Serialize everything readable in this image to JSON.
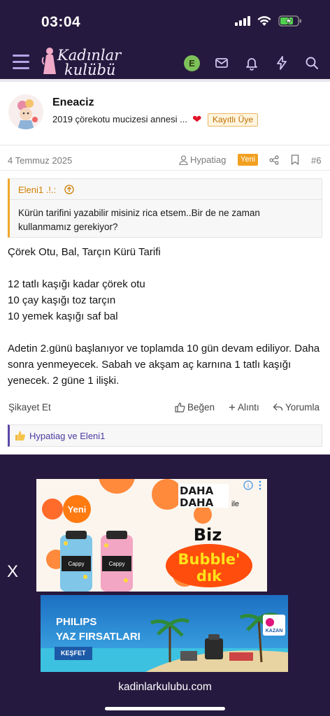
{
  "status": {
    "time": "03:04"
  },
  "nav": {
    "logo_line1": "Kadınlar",
    "logo_line2": "kulübü",
    "avatar_letter": "E"
  },
  "post": {
    "username": "Eneaciz",
    "user_title": "2019 çörekotu mucizesi annesi ...",
    "user_badge": "Kayıtlı Üye",
    "date": "4 Temmuz 2025",
    "meta_user": "Hypatiag",
    "new_badge": "Yeni",
    "post_number": "#6",
    "quote_author": "Eleni1 .!.:",
    "quote_text": "Kürün tarifini yazabilir misiniz rica etsem..Bir de ne zaman kullanmamız gerekiyor?",
    "body": {
      "line1": "Çörek Otu, Bal, Tarçın Kürü Tarifi",
      "line2": "12 tatlı kaşığı kadar çörek otu",
      "line3": "10 çay kaşığı toz tarçın",
      "line4": "10 yemek kaşığı saf bal",
      "line5": "Adetin 2.günü başlanıyor ve toplamda 10 gün devam ediliyor. Daha sonra yenmeyecek. Sabah ve akşam aç karnına 1 tatlı kaşığı yenecek. 2 güne 1 ilişki."
    },
    "actions": {
      "report": "Şikayet Et",
      "like": "Beğen",
      "quote": "Alıntı",
      "reply": "Yorumla"
    },
    "reactions_text": "Hypatiag ve Eleni1"
  },
  "ads": {
    "close": "X",
    "ad1": {
      "yeni": "Yeni",
      "daha1": "DAHA",
      "daha2": "DAHA",
      "ile": "ile",
      "biz": "Biz",
      "bubble": "Bubble'",
      "dik": "dık",
      "bottle": "Cappy"
    },
    "ad2": {
      "line1": "PHILIPS",
      "line2": "YAZ FIRSATLARI",
      "cta": "KEŞFET",
      "kazan": "KAZAN"
    }
  },
  "browser": {
    "url": "kadinlarkulubu.com"
  },
  "colors": {
    "nav_bg": "#26193f",
    "accent_orange": "#f2a020",
    "accent_purple": "#5a46a8",
    "heart": "#e0142a"
  }
}
